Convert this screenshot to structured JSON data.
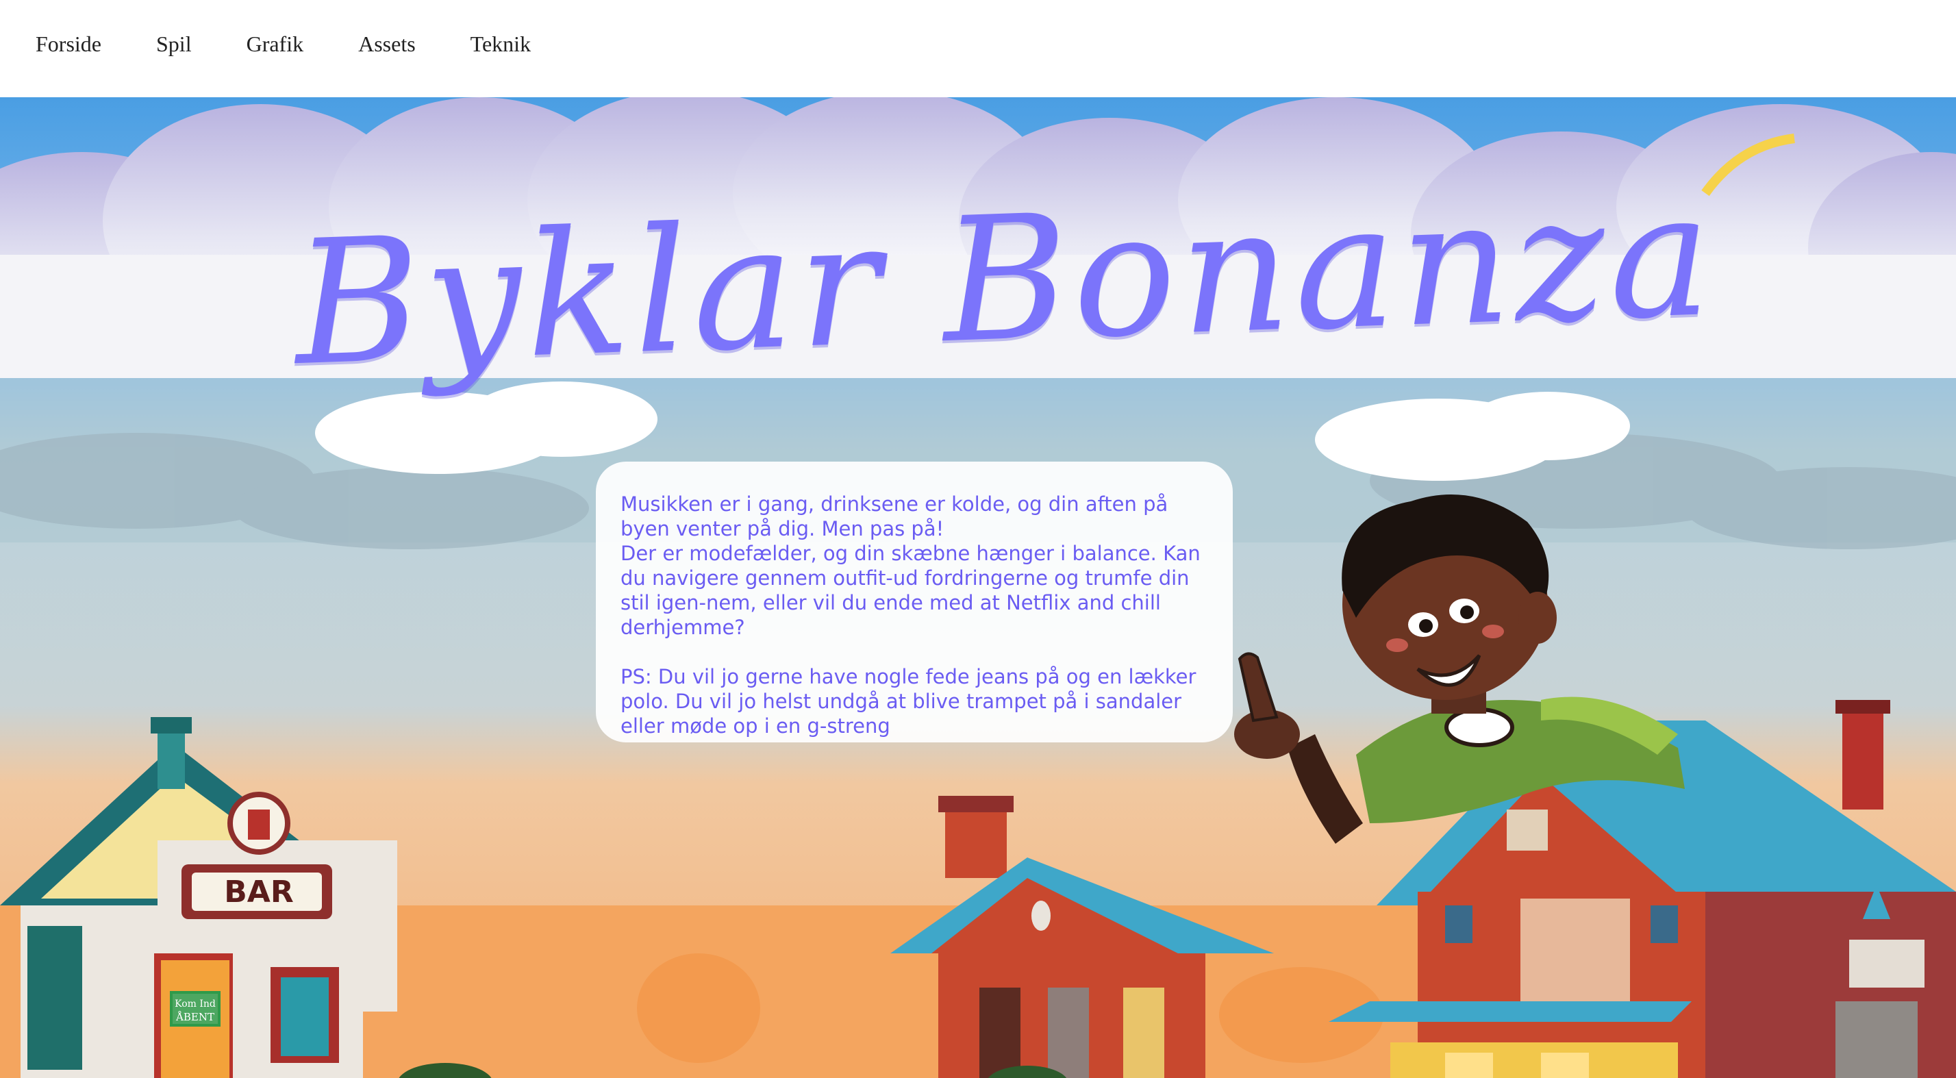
{
  "nav": {
    "items": [
      {
        "label": "Forside"
      },
      {
        "label": "Spil"
      },
      {
        "label": "Grafik"
      },
      {
        "label": "Assets"
      },
      {
        "label": "Teknik"
      }
    ]
  },
  "hero": {
    "title": "Byklar Bonanza",
    "intro": {
      "line1": "Musikken er i gang, drinksene er kolde, og din aften på byen venter på dig. Men pas på!",
      "line2": "Der er modefælder, og din skæbne hænger i balance. Kan du navigere gennem outfit-ud fordringerne og trumfe din stil igen-nem, eller vil du ende med at Netflix and chill derhjemme?",
      "line3": "PS: Du vil jo gerne have nogle fede jeans på og en lækker polo. Du vil jo helst undgå at blive trampet på i sandaler eller møde op i en g-streng"
    },
    "bar_sign": "BAR",
    "door_sign_1": "Kom Ind",
    "door_sign_2": "ÅBENT"
  },
  "colors": {
    "sky": "#4a9ee3",
    "title": "#7b74fb",
    "card_text": "#6a5cf2",
    "sand": "#f3c08a",
    "roof_blue": "#3fa7c9",
    "brick": "#c8482e"
  }
}
